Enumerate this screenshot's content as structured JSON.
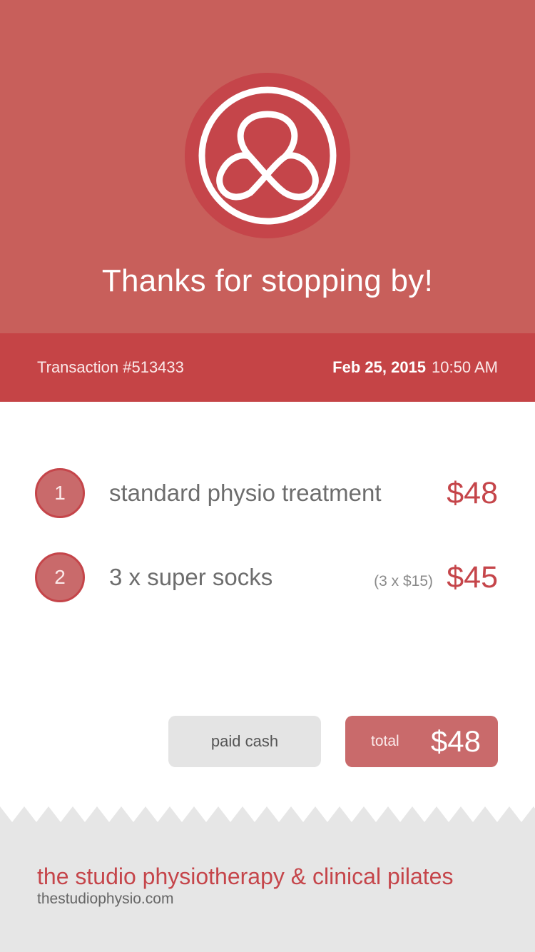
{
  "colors": {
    "hero_bg": "#c85f5b",
    "transaction_bar_bg": "#c54446",
    "accent": "#c5454a",
    "badge_bg": "#c96a6b",
    "footer_bg": "#e6e6e6",
    "pay_method_bg": "#e4e4e4"
  },
  "logo": {
    "icon": "studio-physio-logo-icon"
  },
  "hero": {
    "title": "Thanks for stopping by!"
  },
  "transaction": {
    "number": "Transaction #513433",
    "date": "Feb 25, 2015",
    "time": "10:50 AM"
  },
  "items": [
    {
      "index": "1",
      "label": "standard physio treatment",
      "unit_price": "",
      "price": "$48"
    },
    {
      "index": "2",
      "label": "3 x super socks",
      "unit_price": "(3 x $15)",
      "price": "$45"
    }
  ],
  "summary": {
    "payment_method": "paid cash",
    "total_label": "total",
    "total_amount": "$48"
  },
  "footer": {
    "business_name": "the studio physiotherapy & clinical pilates",
    "website": "thestudiophysio.com"
  }
}
